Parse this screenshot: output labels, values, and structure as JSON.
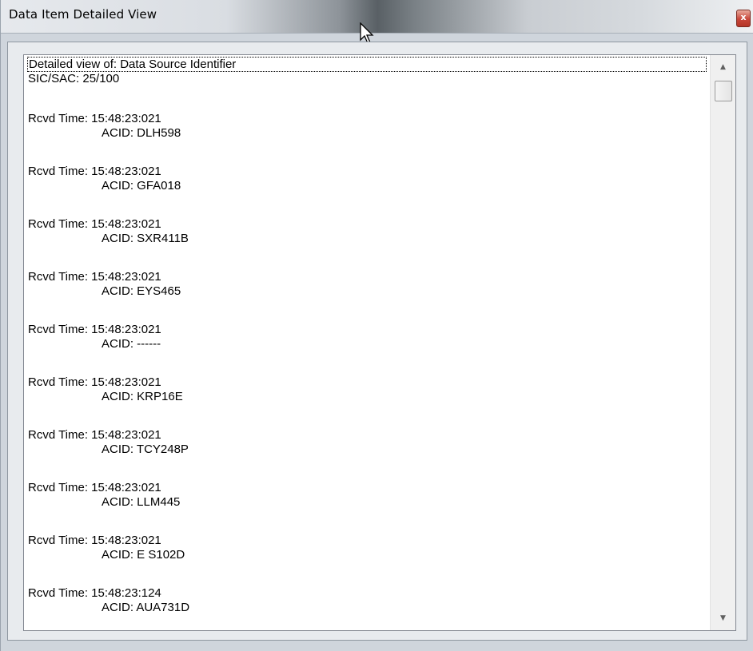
{
  "window": {
    "title": "Data Item Detailed View",
    "close_label": "x"
  },
  "content": {
    "header": "Detailed view of: Data Source Identifier",
    "sic_sac": "SIC/SAC: 25/100",
    "entries": [
      {
        "time": "Rcvd Time: 15:48:23:021",
        "acid": "ACID: DLH598"
      },
      {
        "time": "Rcvd Time: 15:48:23:021",
        "acid": "ACID: GFA018"
      },
      {
        "time": "Rcvd Time: 15:48:23:021",
        "acid": "ACID: SXR411B"
      },
      {
        "time": "Rcvd Time: 15:48:23:021",
        "acid": "ACID: EYS465"
      },
      {
        "time": "Rcvd Time: 15:48:23:021",
        "acid": "ACID: ------"
      },
      {
        "time": "Rcvd Time: 15:48:23:021",
        "acid": "ACID: KRP16E"
      },
      {
        "time": "Rcvd Time: 15:48:23:021",
        "acid": "ACID: TCY248P"
      },
      {
        "time": "Rcvd Time: 15:48:23:021",
        "acid": "ACID: LLM445"
      },
      {
        "time": "Rcvd Time: 15:48:23:021",
        "acid": "ACID: E S102D"
      },
      {
        "time": "Rcvd Time: 15:48:23:124",
        "acid": "ACID: AUA731D"
      }
    ]
  },
  "scrollbar": {
    "up_icon": "scroll-up-arrow-icon",
    "down_icon": "scroll-down-arrow-icon"
  },
  "icons": {
    "close": "close-icon",
    "cursor": "mouse-pointer-icon"
  },
  "colors": {
    "close_button": "#c8473a",
    "window_frame": "#cfd5dc",
    "list_background": "#ffffff"
  }
}
